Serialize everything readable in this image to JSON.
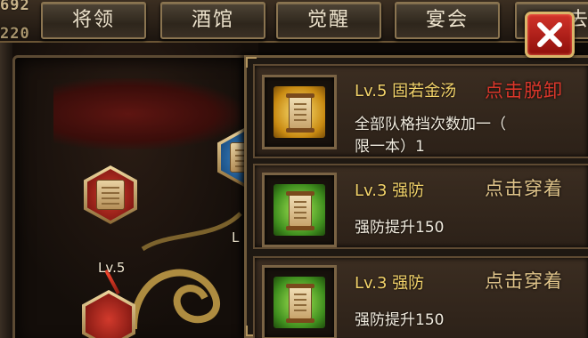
{
  "header": {
    "top_numbers": [
      "692",
      "220"
    ],
    "tabs": [
      "将领",
      "酒馆",
      "觉醒",
      "宴会",
      "去"
    ]
  },
  "close_icon": "close-icon",
  "tree": {
    "node_a_label": "Lv.5",
    "node_b_label": "L"
  },
  "items": [
    {
      "title": "Lv.5 固若金汤",
      "action": "点击脱卸",
      "desc_line1": "全部队格挡次数加一（",
      "desc_line2": "限一本）1",
      "icon": "gold-scroll-icon",
      "action_color": "#d9362a"
    },
    {
      "title": "Lv.3 强防",
      "action": "点击穿着",
      "desc_line1": "强防提升150",
      "icon": "green-scroll-icon",
      "action_color": "#e0c48a"
    },
    {
      "title": "Lv.3 强防",
      "action": "点击穿着",
      "desc_line1": "强防提升150",
      "icon": "green-scroll-icon",
      "action_color": "#e0c48a"
    }
  ]
}
